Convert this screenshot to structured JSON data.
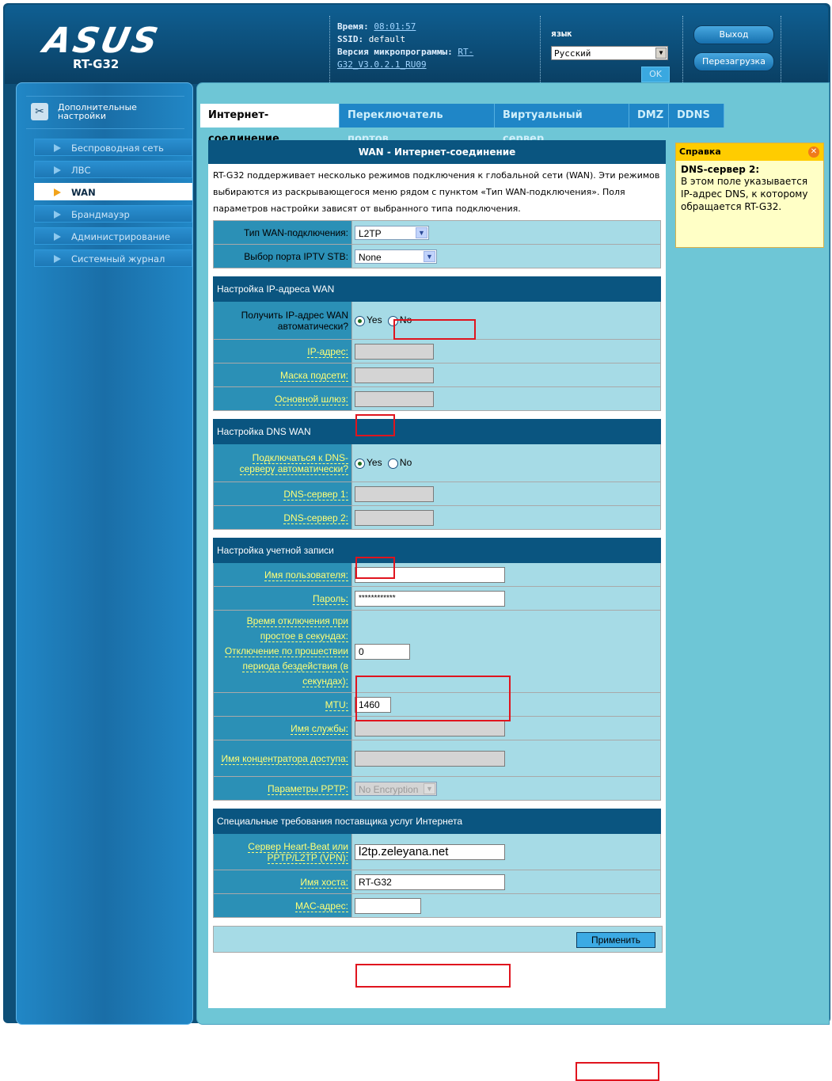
{
  "header": {
    "brand": "ASUS",
    "model": "RT-G32",
    "time_label": "Время:",
    "time_value": "08:01:57",
    "ssid_label": "SSID:",
    "ssid_value": "default",
    "firmware_label": "Версия микропрограммы:",
    "firmware_value": "RT-G32_V3.0.2.1_RU09",
    "language_label": "язык",
    "language_value": "Русский",
    "ok_label": "OK",
    "logout_label": "Выход",
    "reboot_label": "Перезагрузка"
  },
  "sidebar": {
    "advanced_label": "Дополнительные настройки",
    "items": [
      {
        "label": "Беспроводная сеть",
        "active": false
      },
      {
        "label": "ЛВС",
        "active": false
      },
      {
        "label": "WAN",
        "active": true
      },
      {
        "label": "Брандмауэр",
        "active": false
      },
      {
        "label": "Администрирование",
        "active": false
      },
      {
        "label": "Системный журнал",
        "active": false
      }
    ]
  },
  "tabs": [
    {
      "label": "Интернет-соединение",
      "active": true
    },
    {
      "label": "Переключатель портов",
      "active": false
    },
    {
      "label": "Виртуальный сервер",
      "active": false
    },
    {
      "label": "DMZ",
      "active": false
    },
    {
      "label": "DDNS",
      "active": false
    }
  ],
  "panel": {
    "title": "WAN - Интернет-соединение",
    "description": "RT-G32 поддерживает несколько режимов подключения к глобальной сети (WAN). Эти режимов выбираются из раскрывающегося меню рядом с пунктом «Тип WAN-подключения». Поля параметров настройки зависят от выбранного типа подключения.",
    "wan_type_label": "Тип WAN-подключения:",
    "wan_type_value": "L2TP",
    "iptv_label": "Выбор порта IPTV STB:",
    "iptv_value": "None",
    "ip_section": "Настройка IP-адреса WAN",
    "auto_ip_label": "Получить IP-адрес WAN автоматически?",
    "yes": "Yes",
    "no": "No",
    "ip_label": "IP-адрес:",
    "mask_label": "Маска подсети:",
    "gateway_label": "Основной шлюз:",
    "dns_section": "Настройка DNS WAN",
    "auto_dns_label": "Подключаться к DNS-серверу автоматически?",
    "dns1_label": "DNS-сервер 1:",
    "dns2_label": "DNS-сервер 2:",
    "account_section": "Настройка учетной записи",
    "username_label": "Имя пользователя:",
    "username_value": "",
    "password_label": "Пароль:",
    "password_value": "************",
    "idle_label": "Время отключения при простое в секундах: Отключение по прошествии периода бездействия (в секундах):",
    "idle_value": "0",
    "mtu_label": "MTU:",
    "mtu_value": "1460",
    "service_label": "Имя службы:",
    "ac_label": "Имя концентратора доступа:",
    "pptp_label": "Параметры PPTP:",
    "pptp_value": "No Encryption",
    "isp_section": "Специальные требования поставщика услуг Интернета",
    "heartbeat_label": "Сервер Heart-Beat или PPTP/L2TP (VPN):",
    "heartbeat_value": "l2tp.zeleyana.net",
    "hostname_label": "Имя хоста:",
    "hostname_value": "RT-G32",
    "mac_label": "MAC-адрес:",
    "mac_value": "",
    "apply_label": "Применить"
  },
  "help": {
    "title": "Справка",
    "heading": "DNS-сервер 2:",
    "body": "В этом поле указывается IP-адрес DNS, к которому обращается RT-G32."
  }
}
